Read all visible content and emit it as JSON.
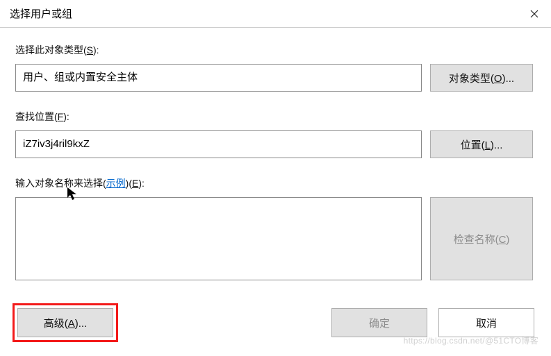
{
  "window": {
    "title": "选择用户或组"
  },
  "sections": {
    "object_type": {
      "label_prefix": "选择此对象类型(",
      "label_key": "S",
      "label_suffix": "):",
      "value": "用户、组或内置安全主体",
      "button_prefix": "对象类型(",
      "button_key": "O",
      "button_suffix": ")..."
    },
    "location": {
      "label_prefix": "查找位置(",
      "label_key": "F",
      "label_suffix": "):",
      "value": "iZ7iv3j4ril9kxZ",
      "button_prefix": "位置(",
      "button_key": "L",
      "button_suffix": ")..."
    },
    "names": {
      "label_before_link": "输入对象名称来选择(",
      "link_text": "示例",
      "label_after_link_prefix": ")(",
      "label_key": "E",
      "label_suffix": "):",
      "value": "",
      "check_button_prefix": "检查名称(",
      "check_button_key": "C",
      "check_button_suffix": ")"
    }
  },
  "buttons": {
    "advanced_prefix": "高级(",
    "advanced_key": "A",
    "advanced_suffix": ")...",
    "ok": "确定",
    "cancel": "取消"
  },
  "watermark": "https://blog.csdn.net/@51CTO博客"
}
